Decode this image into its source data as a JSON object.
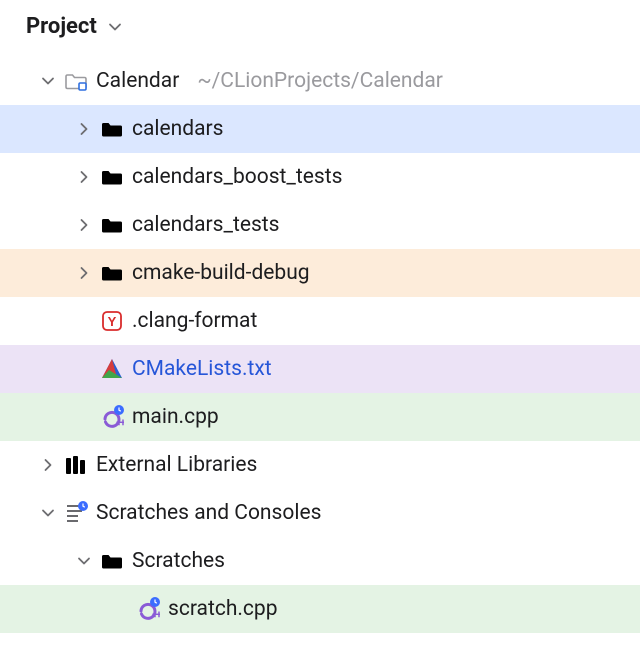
{
  "header": {
    "title": "Project"
  },
  "tree": {
    "project": {
      "name": "Calendar",
      "path": "~/CLionProjects/Calendar"
    },
    "calendars": "calendars",
    "calendars_boost_tests": "calendars_boost_tests",
    "calendars_tests": "calendars_tests",
    "cmake_build_debug": "cmake-build-debug",
    "clang_format": ".clang-format",
    "cmakelists": "CMakeLists.txt",
    "main_cpp": "main.cpp",
    "external_libraries": "External Libraries",
    "scratches_consoles": "Scratches and Consoles",
    "scratches": "Scratches",
    "scratch_cpp": "scratch.cpp"
  }
}
